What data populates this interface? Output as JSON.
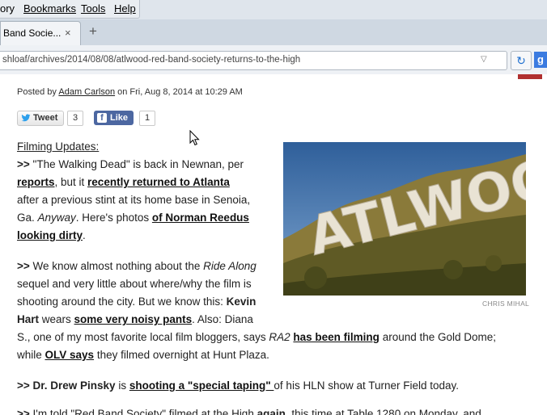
{
  "menu": {
    "items": [
      "ory",
      "Bookmarks",
      "Tools",
      "Help"
    ]
  },
  "tab": {
    "title": "Band Socie...",
    "close": "×",
    "new_tab": "+"
  },
  "address": {
    "url": "shloaf/archives/2014/08/08/atlwood-red-band-society-returns-to-the-high",
    "search_letter": "g"
  },
  "post": {
    "by_prefix": "Posted by ",
    "author": "Adam Carlson",
    "date_text": " on Fri, Aug 8, 2014 at 10:29 AM",
    "tweet_label": "Tweet",
    "tweet_count": "3",
    "like_label": "Like",
    "like_count": "1"
  },
  "photo": {
    "sign_text": "ATLWOOD",
    "credit": "CHRIS MIHAL"
  },
  "article": {
    "heading": "Filming Updates:",
    "p1_l1_pre": ">>",
    "p1_l1": " \"The Walking Dead\" is back in Newnan, per",
    "p1_l2_link1": "reports",
    "p1_l2_mid": ", but it ",
    "p1_l2_link2": "recently returned to Atlanta",
    "p1_l3": "after a previous stint at its home base in Senoia,",
    "p1_l4_pre": "Ga. ",
    "p1_l4_em": "Anyway",
    "p1_l4_mid": ". Here's photos ",
    "p1_l4_link": "of Norman Reedus",
    "p1_l5_link": "looking dirty",
    "p1_l5_end": ".",
    "p2_l1_pre": ">>",
    "p2_l1": " We know almost nothing about the ",
    "p2_l1_em": "Ride Along",
    "p2_l2": "sequel and very little about where/why the film is",
    "p2_l3_pre": "shooting around the city. But we know this: ",
    "p2_l3_bold": "Kevin",
    "p2_l4_bold": "Hart",
    "p2_l4_mid": " wears ",
    "p2_l4_link": "some very noisy pants",
    "p2_l4_end": ". Also: Diana",
    "p2_l5_pre": "S., one of my most favorite local film bloggers, says ",
    "p2_l5_em": "RA2",
    "p2_l5_link": "has been filming",
    "p2_l5_end": " around the Gold Dome;",
    "p2_l6_pre": "while ",
    "p2_l6_link": "OLV says",
    "p2_l6_end": " they filmed overnight at Hunt Plaza.",
    "p3_pre": ">> Dr. Drew Pinsky",
    "p3_mid": " is ",
    "p3_link": "shooting a \"special taping\" ",
    "p3_end": "of his HLN show at Turner Field today.",
    "p4_pre": ">>",
    "p4_mid": " I'm told \"Red Band Society\" filmed at the High ",
    "p4_bold": "again",
    "p4_end": ", this time at Table 1280 on Monday, and"
  },
  "colors": {
    "facebook": "#4c67a1",
    "twitter": "#2ea0ec",
    "chrome_bg": "#dfe5ec"
  }
}
